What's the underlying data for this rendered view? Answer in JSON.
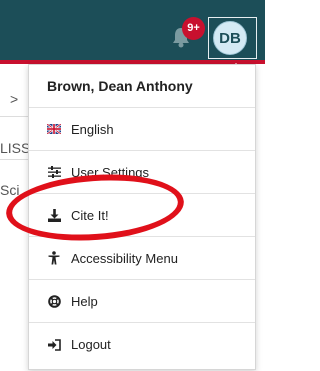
{
  "header": {
    "notification_count": "9+",
    "avatar_initials": "DB"
  },
  "background": {
    "row1_text": ">",
    "row2_text": "LISS",
    "row3_text": "Sci"
  },
  "menu": {
    "user_name": "Brown, Dean Anthony",
    "items": [
      {
        "label": "English",
        "icon": "uk-flag-icon"
      },
      {
        "label": "User Settings",
        "icon": "sliders-icon"
      },
      {
        "label": "Cite It!",
        "icon": "download-icon"
      },
      {
        "label": "Accessibility Menu",
        "icon": "accessibility-icon"
      },
      {
        "label": "Help",
        "icon": "lifebuoy-icon"
      },
      {
        "label": "Logout",
        "icon": "logout-icon"
      }
    ]
  },
  "colors": {
    "topbar": "#1c4e58",
    "accent_red": "#c8102e",
    "annotation_oval": "#e0101a"
  }
}
